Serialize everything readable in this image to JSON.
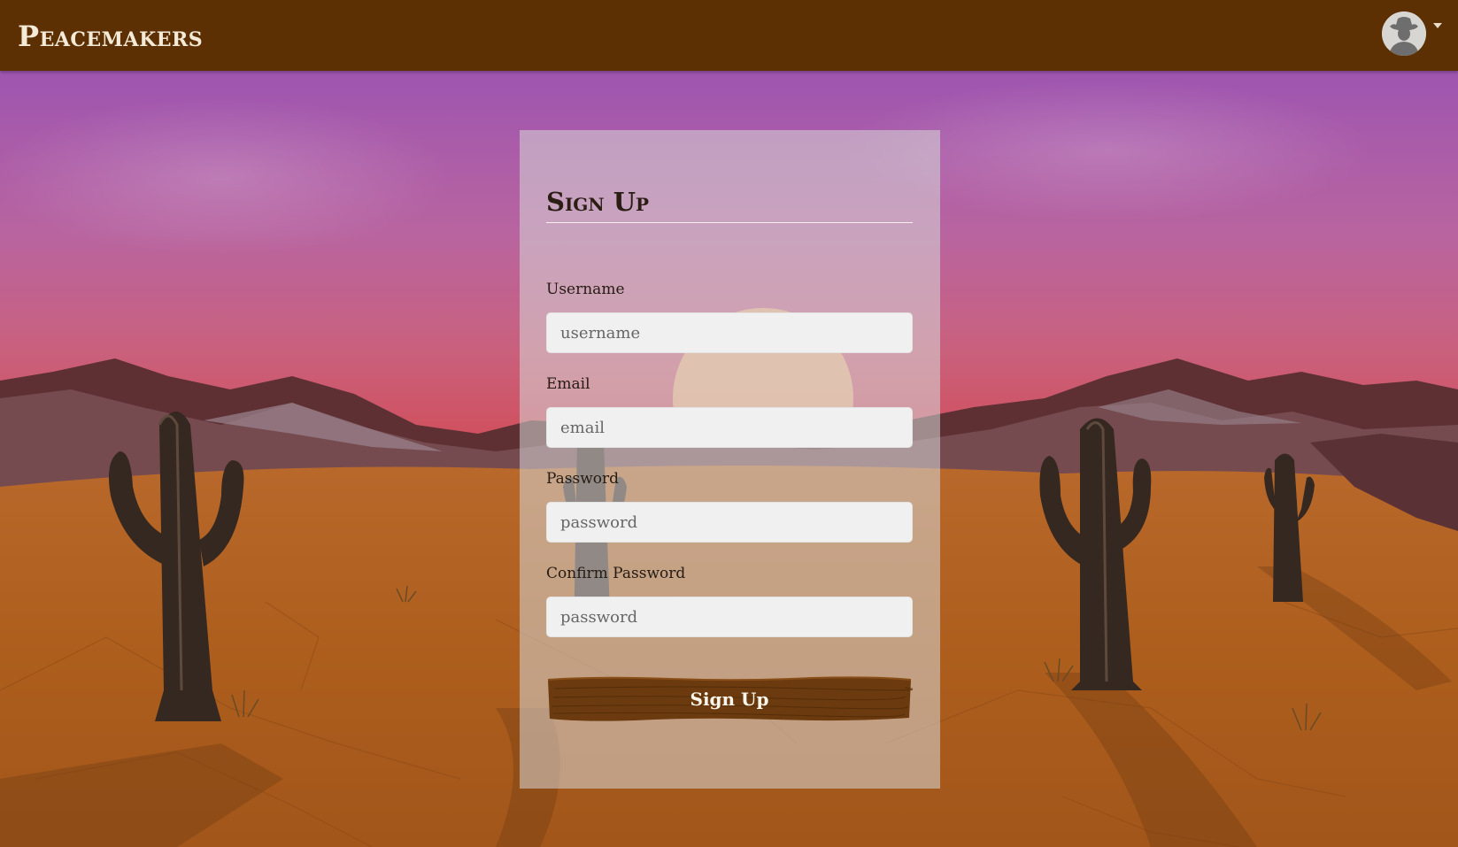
{
  "app": {
    "brand": "Peacemakers"
  },
  "header": {
    "avatar_icon": "cowboy-avatar-icon",
    "menu_icon": "caret-down-icon"
  },
  "form": {
    "title": "Sign Up",
    "fields": [
      {
        "label": "Username",
        "placeholder": "username",
        "value": ""
      },
      {
        "label": "Email",
        "placeholder": "email",
        "value": ""
      },
      {
        "label": "Password",
        "placeholder": "password",
        "value": ""
      },
      {
        "label": "Confirm Password",
        "placeholder": "password",
        "value": ""
      }
    ],
    "submit_label": "Sign Up"
  },
  "colors": {
    "topbar": "#5c3003",
    "button": "#6b3a0e",
    "sky_top": "#9e55b0",
    "sky_horizon": "#cf4f5d",
    "desert": "#a95d1c"
  }
}
